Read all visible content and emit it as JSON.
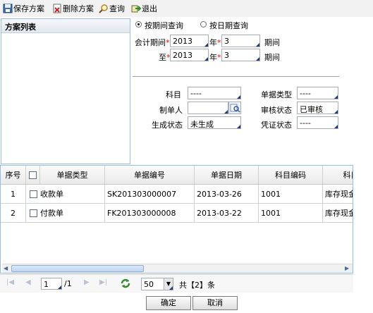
{
  "toolbar": {
    "save_label": "保存方案",
    "delete_label": "删除方案",
    "query_label": "查询",
    "exit_label": "退出"
  },
  "scheme_list": {
    "title": "方案列表"
  },
  "query_mode": {
    "by_period_label": "按期间查询",
    "by_date_label": "按日期查询",
    "selected": "by_period"
  },
  "period": {
    "from_label": "会计期间",
    "to_label": "至",
    "year_label": "年",
    "period_label": "期间",
    "from_year": "2013",
    "from_period": "3",
    "to_year": "2013",
    "to_period": "3"
  },
  "filters": {
    "subject_label": "科目",
    "subject_value": "----",
    "doc_type_label": "单据类型",
    "doc_type_value": "----",
    "creator_label": "制单人",
    "creator_value": "",
    "audit_label": "审核状态",
    "audit_value": "已审核",
    "gen_label": "生成状态",
    "gen_value": "未生成",
    "voucher_label": "凭证状态",
    "voucher_value": "----"
  },
  "grid": {
    "columns": [
      "序号",
      "单据类型",
      "单据编号",
      "单据日期",
      "科目编码",
      "科目"
    ],
    "rows": [
      {
        "no": "1",
        "type": "收款单",
        "code": "SK201303000007",
        "date": "2013-03-26",
        "subject_code": "1001",
        "subject": "库存现金"
      },
      {
        "no": "2",
        "type": "付款单",
        "code": "FK201303000008",
        "date": "2013-03-22",
        "subject_code": "1001",
        "subject": "库存现金"
      }
    ]
  },
  "pager": {
    "page": "1",
    "total_pages": "/1",
    "page_size": "50",
    "total_text": "共【2】条"
  },
  "actions": {
    "ok_label": "确定",
    "cancel_label": "取消"
  },
  "colors": {
    "accent": "#99bbe8",
    "required": "#ff0000"
  }
}
